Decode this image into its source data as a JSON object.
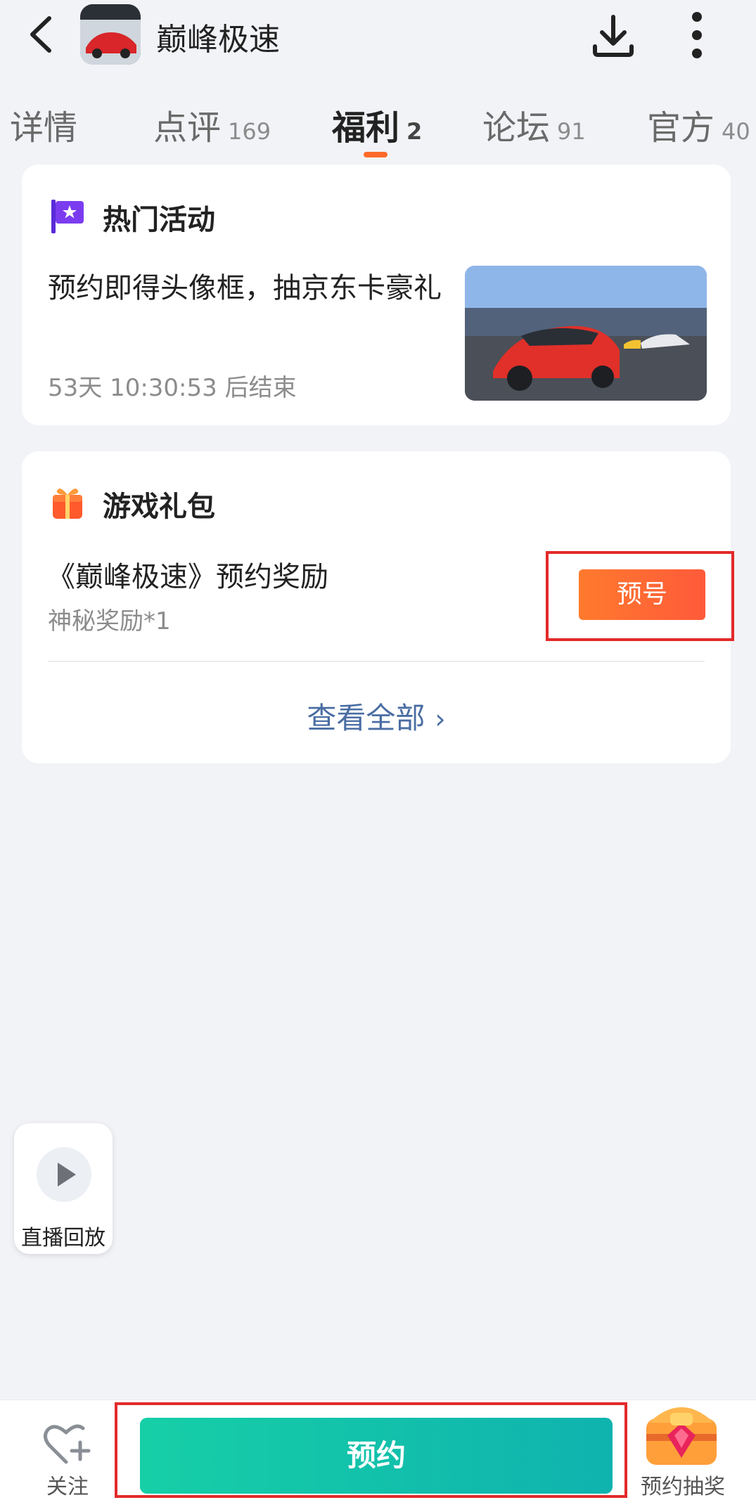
{
  "header": {
    "title": "巅峰极速",
    "icons": [
      "back-icon",
      "app-icon",
      "download-icon",
      "more-icon"
    ]
  },
  "tabs": [
    {
      "label": "详情",
      "count": ""
    },
    {
      "label": "点评",
      "count": "169"
    },
    {
      "label": "福利",
      "count": "2",
      "active": true
    },
    {
      "label": "论坛",
      "count": "91"
    },
    {
      "label": "官方",
      "count": "40"
    }
  ],
  "hot_activity": {
    "title": "热门活动",
    "description": "预约即得头像框，抽京东卡豪礼",
    "time_left": "53天 10:30:53 后结束"
  },
  "game_gift": {
    "title": "游戏礼包",
    "gift_name": "《巅峰极速》预约奖励",
    "gift_sub": "神秘奖励*1",
    "action_label": "预号",
    "view_all": "查看全部"
  },
  "replay": {
    "label": "直播回放"
  },
  "bottom_bar": {
    "follow_label": "关注",
    "reserve_label": "预约",
    "lottery_label": "预约抽奖"
  },
  "colors": {
    "accent_orange": "#ff6a2a",
    "reserve_green": "#16cfa7",
    "link_blue": "#4a6da3",
    "highlight_red": "#e32a2a"
  }
}
